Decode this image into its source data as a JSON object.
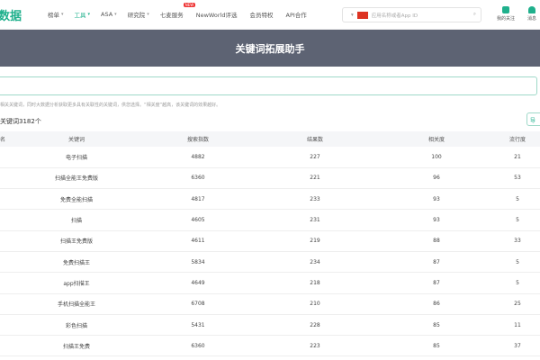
{
  "nav": {
    "logo": "数据",
    "items": [
      "榜单",
      "工具",
      "ASA",
      "研究院",
      "七麦服务",
      "NewWorld评选",
      "会员特权",
      "API合作"
    ],
    "new_badge": "NEW",
    "search_placeholder": "应用名称或者App ID",
    "follow": "我的关注",
    "message": "消息"
  },
  "banner": {
    "title": "关键词拓展助手"
  },
  "hint": "相关关键词，同时大数据分析获取更多具有关联性的关键词，供您选择。“相关度”越高，该关键词的效果越好。",
  "count": "关键词3182个",
  "export": "导",
  "table": {
    "headers": [
      "名",
      "关键词",
      "搜索指数",
      "结果数",
      "相关度",
      "流行度"
    ],
    "rows": [
      [
        "电子扫描",
        "4882",
        "227",
        "100",
        "21"
      ],
      [
        "扫描全能王免费版",
        "6360",
        "221",
        "96",
        "53"
      ],
      [
        "免费全能扫描",
        "4817",
        "233",
        "93",
        "5"
      ],
      [
        "扫描",
        "4605",
        "231",
        "93",
        "5"
      ],
      [
        "扫描王免费版",
        "4611",
        "219",
        "88",
        "33"
      ],
      [
        "免费扫描王",
        "5834",
        "234",
        "87",
        "5"
      ],
      [
        "app扫描王",
        "4649",
        "218",
        "87",
        "5"
      ],
      [
        "手机扫描全能王",
        "6708",
        "210",
        "86",
        "25"
      ],
      [
        "彩色扫描",
        "5431",
        "228",
        "85",
        "11"
      ],
      [
        "扫描王免费",
        "6360",
        "223",
        "85",
        "37"
      ]
    ]
  }
}
